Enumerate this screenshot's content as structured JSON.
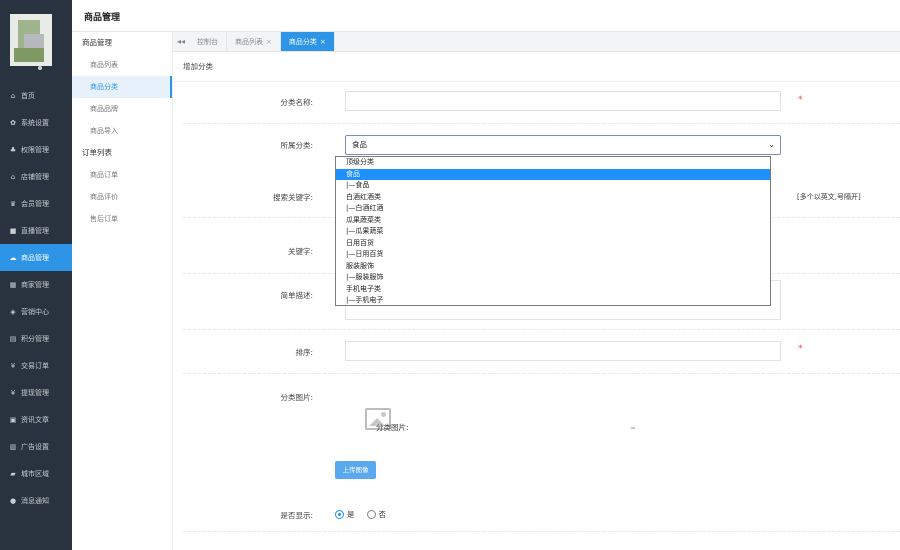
{
  "page_title": "商品管理",
  "sidebar": {
    "items": [
      {
        "icon": "home-icon",
        "glyph": "⌂",
        "label": "首页"
      },
      {
        "icon": "gear-icon",
        "glyph": "✿",
        "label": "系统设置"
      },
      {
        "icon": "org-icon",
        "glyph": "♣",
        "label": "权限管理"
      },
      {
        "icon": "shop-icon",
        "glyph": "⌂",
        "label": "店铺管理"
      },
      {
        "icon": "user-icon",
        "glyph": "♛",
        "label": "会员管理"
      },
      {
        "icon": "video-icon",
        "glyph": "■",
        "label": "直播管理"
      },
      {
        "icon": "goods-icon",
        "glyph": "☁",
        "label": "商品管理"
      },
      {
        "icon": "merchant-icon",
        "glyph": "▦",
        "label": "商家管理"
      },
      {
        "icon": "marketing-icon",
        "glyph": "◈",
        "label": "营销中心"
      },
      {
        "icon": "points-icon",
        "glyph": "▤",
        "label": "积分管理"
      },
      {
        "icon": "order-icon",
        "glyph": "¥",
        "label": "交易订单"
      },
      {
        "icon": "withdraw-icon",
        "glyph": "¥",
        "label": "提现管理"
      },
      {
        "icon": "article-icon",
        "glyph": "▣",
        "label": "资讯文章"
      },
      {
        "icon": "ad-icon",
        "glyph": "▥",
        "label": "广告设置"
      },
      {
        "icon": "map-icon",
        "glyph": "▰",
        "label": "城市区域"
      },
      {
        "icon": "message-icon",
        "glyph": "●",
        "label": "消息通知"
      }
    ],
    "active_index": 6
  },
  "submenu": {
    "group1": "商品管理",
    "items1": [
      "商品列表",
      "商品分类",
      "商品品牌",
      "商品导入"
    ],
    "group2": "订单列表",
    "items2": [
      "商品订单",
      "商品评价",
      "售后订单"
    ]
  },
  "tabs": {
    "nav_glyph": "◂◂",
    "items": [
      {
        "label": "控制台",
        "closable": false
      },
      {
        "label": "商品列表",
        "closable": true
      },
      {
        "label": "商品分类",
        "closable": true
      }
    ],
    "close_glyph": "×"
  },
  "content": {
    "header": "增加分类",
    "form": {
      "name_label": "分类名称:",
      "parent_label": "所属分类:",
      "parent_value": "食品",
      "search_kw_label": "搜索关键字:",
      "search_kw_hint": "[多个以英文,号隔开]",
      "keyword_label": "关键字:",
      "desc_label": "简单描述:",
      "sort_label": "排序:",
      "image_label": "分类图片:",
      "image_alt": "分类图片:",
      "image_mark": "≈",
      "upload_button": "上传图像",
      "show_label": "是否显示:",
      "show_options": [
        "是",
        "否"
      ],
      "required_mark": "*"
    },
    "dropdown_options": [
      {
        "label": "顶级分类",
        "selected": false
      },
      {
        "label": "食品",
        "selected": true
      },
      {
        "label": "|—食品",
        "selected": false
      },
      {
        "label": "白酒红酒类",
        "selected": false
      },
      {
        "label": "|—白酒红酒",
        "selected": false
      },
      {
        "label": "瓜果蔬菜类",
        "selected": false
      },
      {
        "label": "|—瓜果蔬菜",
        "selected": false
      },
      {
        "label": "日用百货",
        "selected": false
      },
      {
        "label": "|—日用百货",
        "selected": false
      },
      {
        "label": "服装服饰",
        "selected": false
      },
      {
        "label": "|—服装服饰",
        "selected": false
      },
      {
        "label": "手机电子类",
        "selected": false
      },
      {
        "label": "|—手机电子",
        "selected": false
      }
    ]
  }
}
